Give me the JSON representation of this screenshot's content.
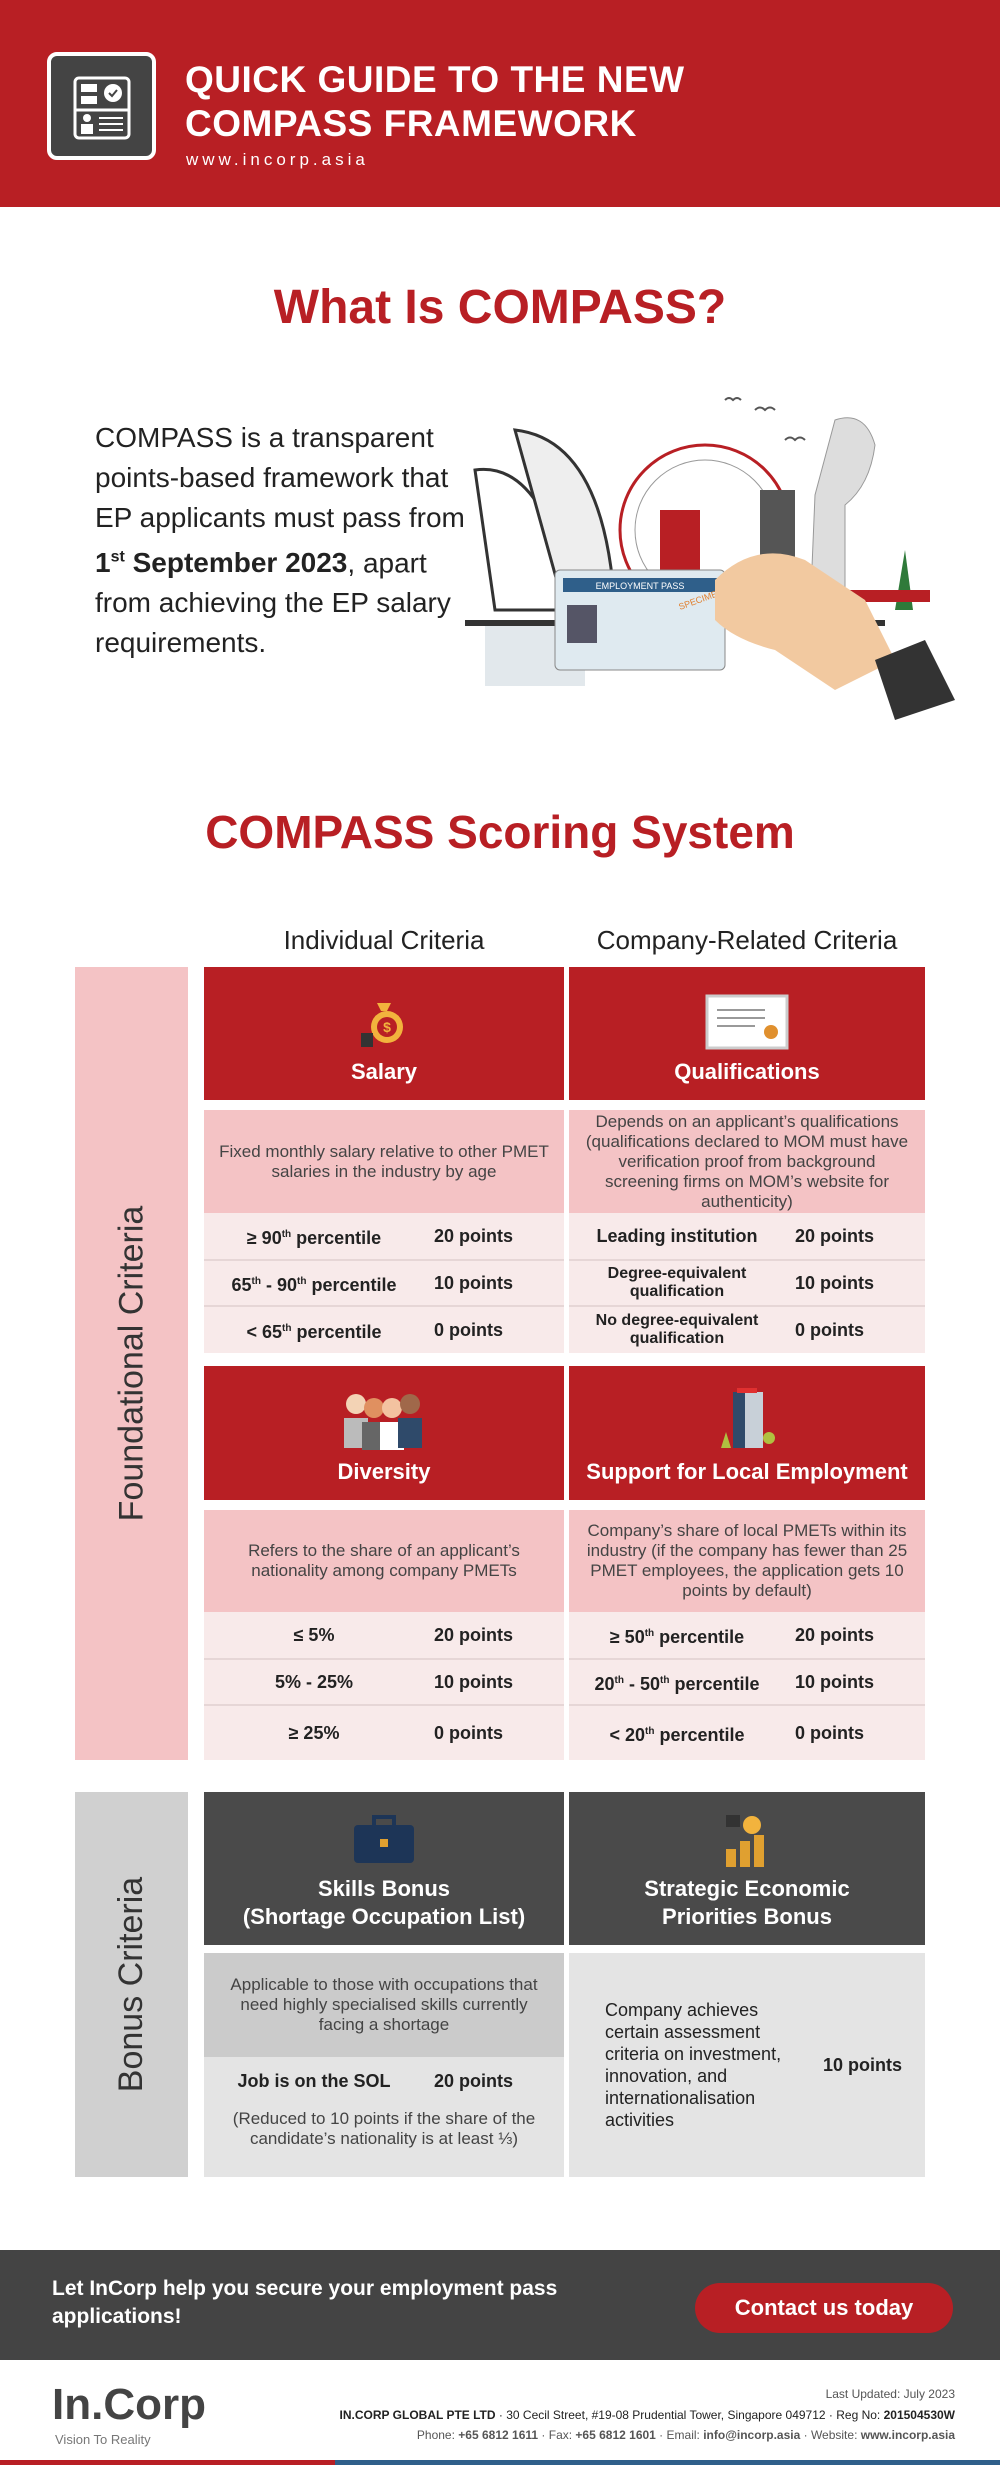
{
  "header": {
    "title_line1": "QUICK GUIDE TO THE NEW",
    "title_line2": "COMPASS FRAMEWORK",
    "url": "www.incorp.asia",
    "icon": "id-card-check-icon"
  },
  "what": {
    "title": "What Is COMPASS?",
    "text_before": "COMPASS is a transparent points-based framework that EP applicants must pass from ",
    "date_num": "1",
    "date_sup": "st",
    "date_rest": " September 2023",
    "text_after": ", apart from achieving the EP salary requirements.",
    "illustration_card": "EMPLOYMENT PASS",
    "illustration_stamp": "SPECIMEN"
  },
  "scoring": {
    "title": "COMPASS Scoring System",
    "col_individual": "Individual Criteria",
    "col_company": "Company-Related Criteria",
    "foundational_label": "Foundational Criteria",
    "bonus_label": "Bonus Criteria",
    "salary": {
      "title": "Salary",
      "icon": "money-bag-icon",
      "desc": "Fixed monthly salary relative to other PMET salaries in the industry by age",
      "rows": [
        {
          "pre": "≥ 90",
          "sup": "th",
          "post": " percentile",
          "points": "20 points"
        },
        {
          "pre": "65",
          "sup": "th",
          "mid": " - 90",
          "sup2": "th",
          "post": " percentile",
          "points": "10 points"
        },
        {
          "pre": "< 65",
          "sup": "th",
          "post": " percentile",
          "points": "0  points"
        }
      ]
    },
    "qualifications": {
      "title": "Qualifications",
      "icon": "certificate-icon",
      "desc": "Depends on an applicant’s qualifications (qualifications declared to MOM must have verification proof from background screening firms on MOM’s website for authenticity)",
      "rows": [
        {
          "label": "Leading institution",
          "points": "20 points"
        },
        {
          "label": "Degree-equivalent qualification",
          "points": "10 points"
        },
        {
          "label": "No degree-equivalent qualification",
          "points": "0  points"
        }
      ]
    },
    "diversity": {
      "title": "Diversity",
      "icon": "people-group-icon",
      "desc": "Refers to the share of an applicant’s nationality among company PMETs",
      "rows": [
        {
          "label": "≤ 5%",
          "points": "20 points"
        },
        {
          "label": "5% - 25%",
          "points": "10 points"
        },
        {
          "label": "≥ 25%",
          "points": "0  points"
        }
      ]
    },
    "local": {
      "title": "Support for Local Employment",
      "icon": "office-building-icon",
      "desc": "Company’s share of local PMETs within its industry (if the company has fewer than 25 PMET employees, the application gets 10 points by default)",
      "rows": [
        {
          "pre": "≥ 50",
          "sup": "th",
          "post": " percentile",
          "points": "20 points"
        },
        {
          "pre": "20",
          "sup": "th",
          "mid": " - 50",
          "sup2": "th",
          "post": " percentile",
          "points": "10 points"
        },
        {
          "pre": "< 20",
          "sup": "th",
          "post": " percentile",
          "points": "0  points"
        }
      ]
    },
    "skills": {
      "title_line1": "Skills Bonus",
      "title_line2": "(Shortage Occupation List)",
      "icon": "briefcase-icon",
      "desc": "Applicable to those with occupations that need highly specialised skills currently facing a shortage",
      "row_label": "Job is on the SOL",
      "row_points": "20 points",
      "note": "(Reduced to 10 points if the share of the candidate’s nationality is at least ⅓)"
    },
    "strategic": {
      "title_line1": "Strategic Economic",
      "title_line2": "Priorities Bonus",
      "icon": "coins-growth-icon",
      "desc": "Company achieves certain assessment criteria on investment, innovation, and internationalisation activities",
      "points": "10 points"
    }
  },
  "cta": {
    "text": "Let InCorp help you secure your employment pass applications!",
    "button": "Contact us today"
  },
  "footer": {
    "logo": "In.Corp",
    "tagline": "Vision To Reality",
    "updated": "Last Updated: July 2023",
    "company": "IN.CORP GLOBAL PTE LTD",
    "address": "30 Cecil Street, #19-08 Prudential Tower, Singapore 049712",
    "reg_label": "Reg No:",
    "reg": "201504530W",
    "phone_label": "Phone:",
    "phone": "+65 6812 1611",
    "fax_label": "Fax:",
    "fax": "+65 6812 1601",
    "email_label": "Email:",
    "email": "info@incorp.asia",
    "website_label": "Website:",
    "website": "www.incorp.asia"
  },
  "colors": {
    "brand_red": "#b81f24",
    "pink": "#f4c3c5",
    "dark": "#4a4a4a",
    "blue": "#2f5f8a"
  }
}
